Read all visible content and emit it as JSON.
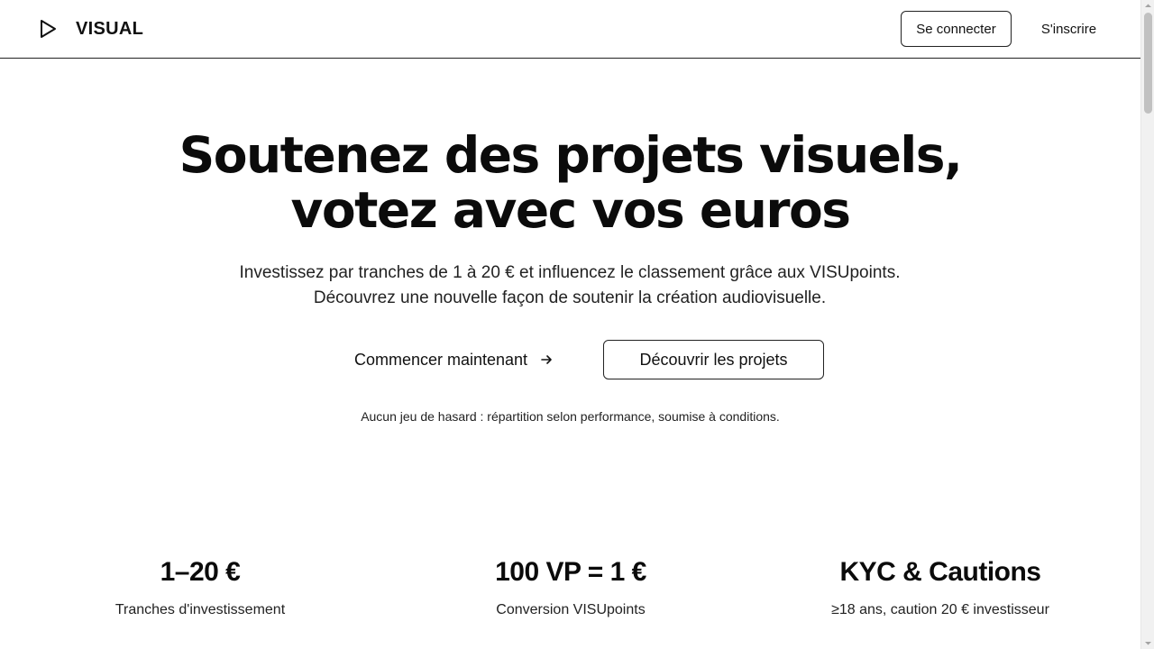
{
  "header": {
    "logo_icon": "play-icon",
    "brand": "VISUAL",
    "login_label": "Se connecter",
    "signup_label": "S'inscrire"
  },
  "hero": {
    "title_line1": "Soutenez des projets visuels,",
    "title_line2": "votez avec vos euros",
    "subtitle": "Investissez par tranches de 1 à 20 € et influencez le classement grâce aux VISUpoints. Découvrez une nouvelle façon de soutenir la création audiovisuelle.",
    "cta_primary": "Commencer maintenant",
    "cta_primary_icon": "arrow-right-icon",
    "cta_secondary": "Découvrir les projets",
    "disclaimer": "Aucun jeu de hasard : répartition selon performance, soumise à conditions."
  },
  "stats": [
    {
      "value": "1–20 €",
      "label": "Tranches d'investissement"
    },
    {
      "value": "100 VP = 1 €",
      "label": "Conversion VISUpoints"
    },
    {
      "value": "KYC & Cautions",
      "label": "≥18 ans, caution 20 € investisseur"
    }
  ],
  "colors": {
    "text": "#111111",
    "border": "#222222",
    "background": "#ffffff"
  }
}
